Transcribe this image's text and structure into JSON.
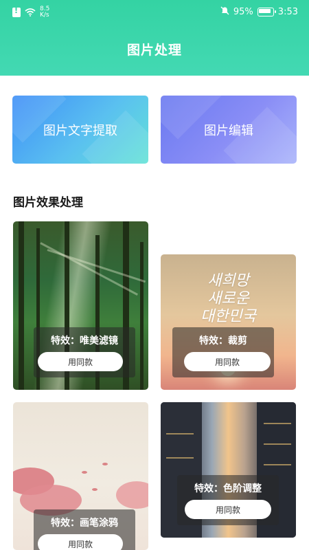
{
  "status_bar": {
    "net_speed_value": "8.5",
    "net_speed_unit": "K/s",
    "battery": "95%",
    "time": "3:53",
    "icons": [
      "sim-alert-icon",
      "wifi-icon",
      "mute-icon",
      "battery-icon"
    ]
  },
  "header": {
    "title": "图片处理"
  },
  "features": [
    {
      "label": "图片文字提取"
    },
    {
      "label": "图片编辑"
    }
  ],
  "section": {
    "title": "图片效果处理"
  },
  "effects": [
    {
      "label": "特效：唯美滤镜",
      "button": "用同款"
    },
    {
      "label": "特效：裁剪",
      "button": "用同款"
    },
    {
      "label": "特效：画笔涂鸦",
      "button": "用同款"
    },
    {
      "label": "特效：色阶调整",
      "button": "用同款"
    }
  ],
  "images": {
    "ec2_script_lines": [
      "새희망",
      "새로운",
      "대한민국"
    ]
  },
  "colors": {
    "header": "#34d3a3",
    "ocr_card": "#3f8ff7",
    "edit_card": "#6a79f0"
  }
}
